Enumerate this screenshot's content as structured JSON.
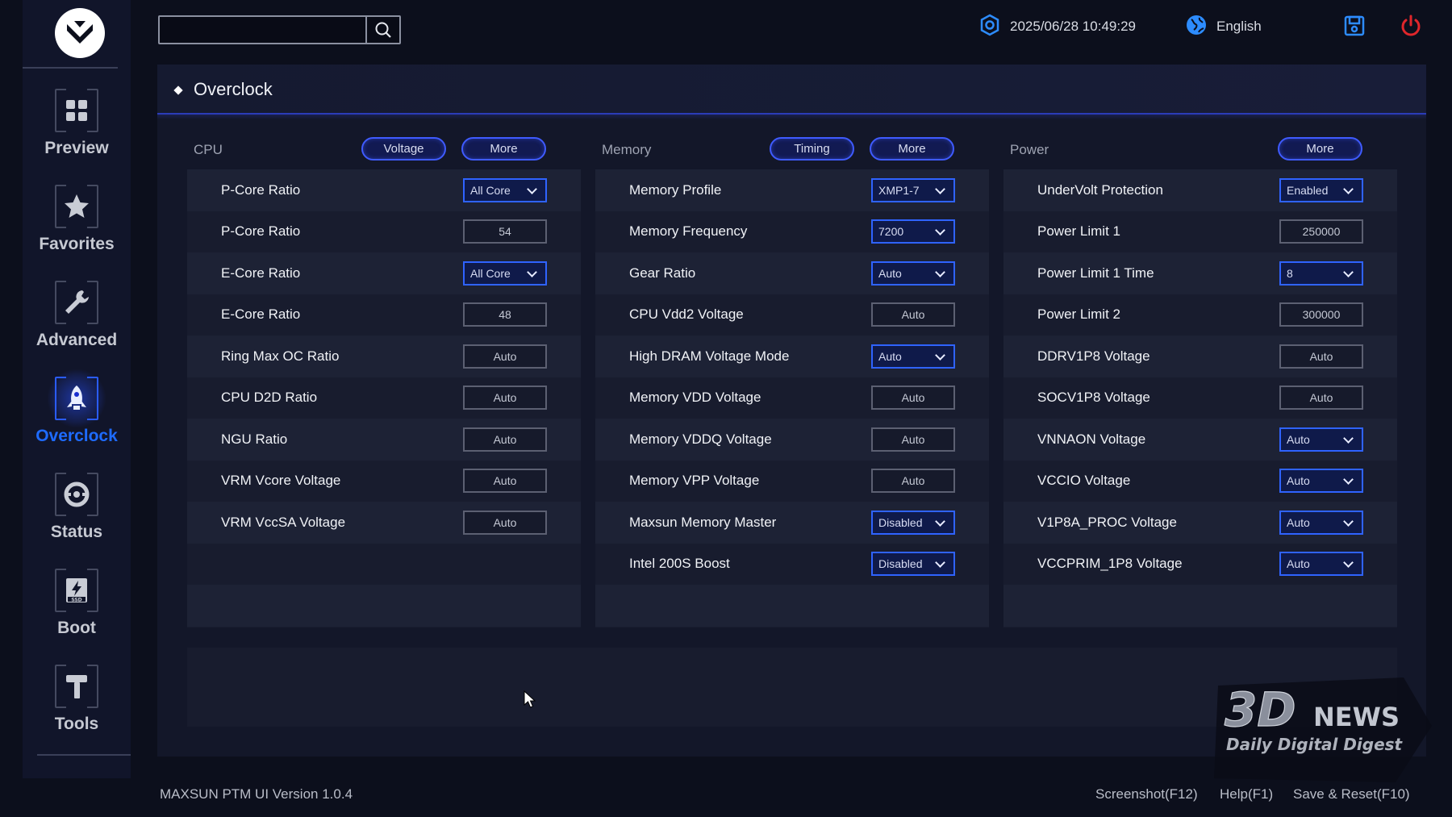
{
  "top": {
    "search_placeholder": "",
    "datetime": "2025/06/28 10:49:29",
    "language": "English"
  },
  "sidebar": {
    "items": [
      {
        "label": "Preview",
        "icon": "grid-icon"
      },
      {
        "label": "Favorites",
        "icon": "star-icon"
      },
      {
        "label": "Advanced",
        "icon": "wrench-icon"
      },
      {
        "label": "Overclock",
        "icon": "rocket-icon",
        "active": true
      },
      {
        "label": "Status",
        "icon": "gauge-icon"
      },
      {
        "label": "Boot",
        "icon": "ssd-icon"
      },
      {
        "label": "Tools",
        "icon": "hammer-icon"
      }
    ]
  },
  "panel": {
    "title": "Overclock"
  },
  "cpu": {
    "title": "CPU",
    "btn_voltage": "Voltage",
    "btn_more": "More",
    "rows": [
      {
        "label": "P-Core Ratio",
        "value": "All Core",
        "type": "select"
      },
      {
        "label": "P-Core Ratio",
        "value": "54",
        "type": "input"
      },
      {
        "label": "E-Core Ratio",
        "value": "All Core",
        "type": "select"
      },
      {
        "label": "E-Core Ratio",
        "value": "48",
        "type": "input"
      },
      {
        "label": "Ring Max OC Ratio",
        "value": "Auto",
        "type": "input"
      },
      {
        "label": "CPU D2D Ratio",
        "value": "Auto",
        "type": "input"
      },
      {
        "label": "NGU Ratio",
        "value": "Auto",
        "type": "input"
      },
      {
        "label": "VRM Vcore Voltage",
        "value": "Auto",
        "type": "input"
      },
      {
        "label": "VRM VccSA Voltage",
        "value": "Auto",
        "type": "input"
      }
    ]
  },
  "memory": {
    "title": "Memory",
    "btn_timing": "Timing",
    "btn_more": "More",
    "rows": [
      {
        "label": "Memory Profile",
        "value": "XMP1-7",
        "type": "select"
      },
      {
        "label": "Memory Frequency",
        "value": "7200",
        "type": "select"
      },
      {
        "label": "Gear Ratio",
        "value": "Auto",
        "type": "select"
      },
      {
        "label": "CPU Vdd2 Voltage",
        "value": "Auto",
        "type": "input"
      },
      {
        "label": "High DRAM Voltage Mode",
        "value": "Auto",
        "type": "select"
      },
      {
        "label": "Memory VDD Voltage",
        "value": "Auto",
        "type": "input"
      },
      {
        "label": "Memory VDDQ Voltage",
        "value": "Auto",
        "type": "input"
      },
      {
        "label": "Memory VPP Voltage",
        "value": "Auto",
        "type": "input"
      },
      {
        "label": "Maxsun Memory Master",
        "value": "Disabled",
        "type": "select"
      },
      {
        "label": "Intel 200S Boost",
        "value": "Disabled",
        "type": "select"
      }
    ]
  },
  "power": {
    "title": "Power",
    "btn_more": "More",
    "rows": [
      {
        "label": "UnderVolt Protection",
        "value": "Enabled",
        "type": "select"
      },
      {
        "label": "Power Limit 1",
        "value": "250000",
        "type": "input"
      },
      {
        "label": "Power Limit 1 Time",
        "value": "8",
        "type": "select"
      },
      {
        "label": "Power Limit 2",
        "value": "300000",
        "type": "input"
      },
      {
        "label": "DDRV1P8 Voltage",
        "value": "Auto",
        "type": "input"
      },
      {
        "label": "SOCV1P8 Voltage",
        "value": "Auto",
        "type": "input"
      },
      {
        "label": "VNNAON Voltage",
        "value": "Auto",
        "type": "select"
      },
      {
        "label": "VCCIO Voltage",
        "value": "Auto",
        "type": "select"
      },
      {
        "label": "V1P8A_PROC Voltage",
        "value": "Auto",
        "type": "select"
      },
      {
        "label": "VCCPRIM_1P8 Voltage",
        "value": "Auto",
        "type": "select"
      }
    ]
  },
  "footer": {
    "version": "MAXSUN PTM UI Version 1.0.4",
    "screenshot": "Screenshot(F12)",
    "help": "Help(F1)",
    "save_reset": "Save & Reset(F10)"
  },
  "watermark": {
    "brand": "3DNEWS",
    "tagline": "Daily Digital Digest"
  },
  "colors": {
    "accent": "#2f63ff",
    "active_nav": "#1e6bff",
    "power": "#e0262b",
    "save": "#2d8cff"
  }
}
